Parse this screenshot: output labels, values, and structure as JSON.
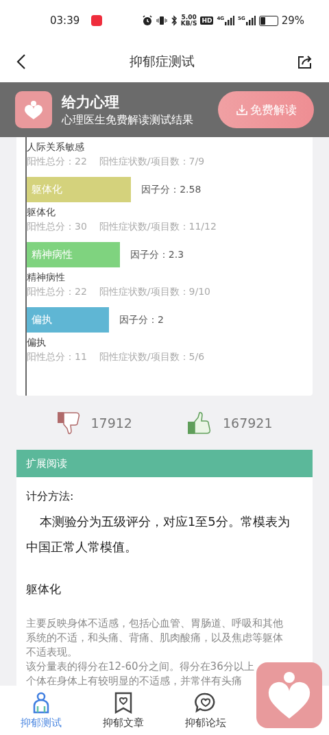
{
  "status_bar": {
    "time": "03:39",
    "speed_value": "5.00",
    "speed_unit": "KB/S",
    "hd": "HD",
    "net_1": "4G",
    "net_2": "5G",
    "battery": "29%"
  },
  "header": {
    "title": "抑郁症测试"
  },
  "banner": {
    "title": "给力心理",
    "subtitle": "心理医生免费解读测试结果",
    "button": "免费解读"
  },
  "factors": [
    {
      "name": "人际关系敏感",
      "total": "阳性总分：22",
      "ratio": "阳性症状数/项目数：7/9"
    },
    {
      "bar_label": "躯体化",
      "score": "因子分：2.58",
      "level": 0.364,
      "color": "#d4d27c",
      "name": "躯体化",
      "total": "阳性总分：30",
      "ratio": "阳性症状数/项目数：11/12"
    },
    {
      "bar_label": "精神病性",
      "score": "因子分：2.3",
      "level": 0.325,
      "color": "#7fd37f",
      "name": "精神病性",
      "total": "阳性总分：22",
      "ratio": "阳性症状数/项目数：9/10"
    },
    {
      "bar_label": "偏执",
      "score": "因子分：2",
      "level": 0.287,
      "color": "#5fb6d4",
      "name": "偏执",
      "total": "阳性总分：11",
      "ratio": "阳性症状数/项目数：5/6"
    }
  ],
  "votes": {
    "dislikes": "17912",
    "likes": "167921"
  },
  "reading": {
    "header": "扩展阅读",
    "method_title": "计分方法:",
    "method_text": "本测验分为五级评分，对应1至5分。常模表为中国正常人常模值。",
    "section_title": "躯体化",
    "paragraphs": [
      "主要反映身体不适感，包括心血管、胃肠道、呼吸和其他系统的不适，和头痛、背痛、肌肉酸痛，以及焦虑等躯体不适表现。",
      "该分量表的得分在12-60分之间。得分在36分以上",
      "个体在身体上有较明显的不适感，并常伴有头痛"
    ]
  },
  "tabs": [
    {
      "label": "抑郁测试",
      "selected": true
    },
    {
      "label": "抑郁文章",
      "selected": false
    },
    {
      "label": "抑郁论坛",
      "selected": false
    }
  ]
}
